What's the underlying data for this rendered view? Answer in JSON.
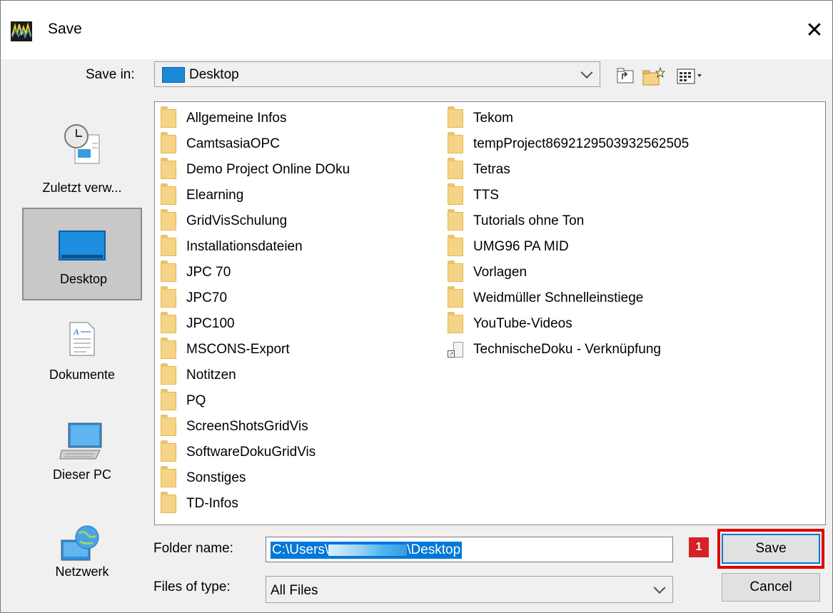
{
  "window": {
    "title": "Save",
    "close_glyph": "✕"
  },
  "toolbar": {
    "save_in_label": "Save in:",
    "location": "Desktop",
    "icons": [
      "up-one-level-icon",
      "create-new-folder-icon",
      "view-menu-icon"
    ]
  },
  "sidebar": {
    "items": [
      {
        "label": "Zuletzt verw...",
        "icon": "recent-items-icon",
        "selected": false
      },
      {
        "label": "Desktop",
        "icon": "desktop-icon",
        "selected": true
      },
      {
        "label": "Dokumente",
        "icon": "documents-icon",
        "selected": false
      },
      {
        "label": "Dieser PC",
        "icon": "this-pc-icon",
        "selected": false
      },
      {
        "label": "Netzwerk",
        "icon": "network-icon",
        "selected": false
      }
    ]
  },
  "files": {
    "column1": [
      "Allgemeine Infos",
      "CamtsasiaOPC",
      "Demo Project Online DOku",
      "Elearning",
      "GridVisSchulung",
      "Installationsdateien",
      "JPC 70",
      "JPC70",
      "JPC100",
      "MSCONS-Export",
      "Notitzen",
      "PQ",
      "ScreenShotsGridVis",
      "SoftwareDokuGridVis",
      "Sonstiges",
      "TD-Infos"
    ],
    "column2": [
      "Tekom",
      "tempProject8692129503932562505",
      "Tetras",
      "TTS",
      "Tutorials ohne Ton",
      "UMG96 PA MID",
      "Vorlagen",
      "Weidmüller Schnelleinstiege",
      "YouTube-Videos",
      "TechnischeDoku - Verknüpfung"
    ]
  },
  "form": {
    "folder_name_label": "Folder name:",
    "folder_name_prefix": "C:\\Users\\",
    "folder_name_suffix": "\\Desktop",
    "files_of_type_label": "Files of type:",
    "files_of_type_value": "All Files"
  },
  "buttons": {
    "save": "Save",
    "cancel": "Cancel"
  },
  "annotation": {
    "badge": "1",
    "highlight_color": "#e00000"
  },
  "colors": {
    "selection": "#0078d7",
    "folder": "#f5d488"
  }
}
